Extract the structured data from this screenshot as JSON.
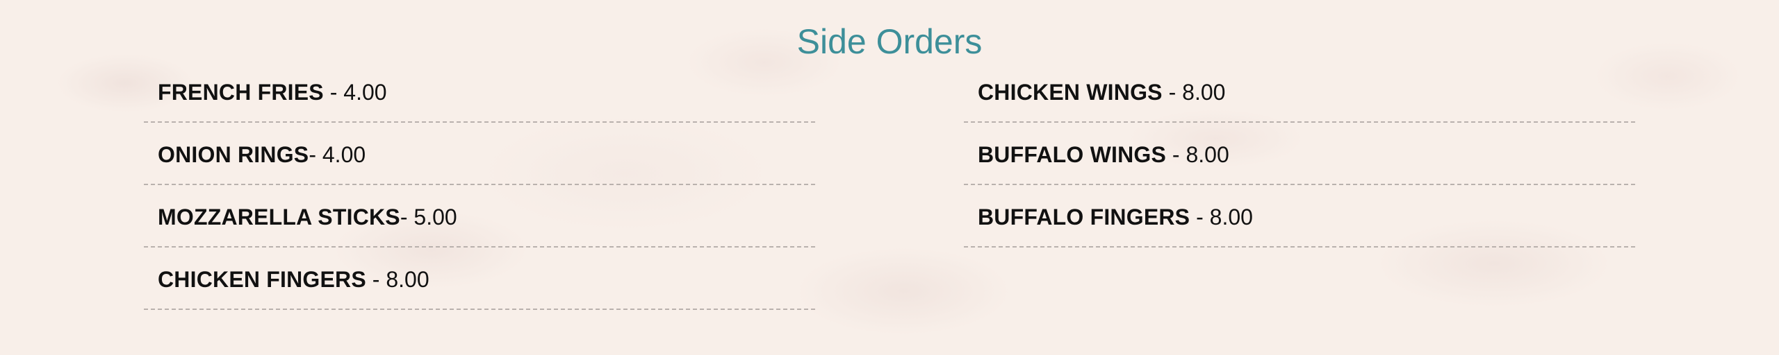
{
  "section": {
    "title": "Side Orders"
  },
  "left_column": [
    {
      "name": "FRENCH FRIES",
      "price": " - 4.00"
    },
    {
      "name": "ONION RINGS",
      "price": "- 4.00"
    },
    {
      "name": "MOZZARELLA STICKS",
      "price": "- 5.00"
    },
    {
      "name": "CHICKEN FINGERS",
      "price": " - 8.00"
    }
  ],
  "right_column": [
    {
      "name": "CHICKEN WINGS",
      "price": " - 8.00"
    },
    {
      "name": "BUFFALO WINGS",
      "price": " - 8.00"
    },
    {
      "name": "BUFFALO FINGERS",
      "price": " - 8.00"
    }
  ]
}
